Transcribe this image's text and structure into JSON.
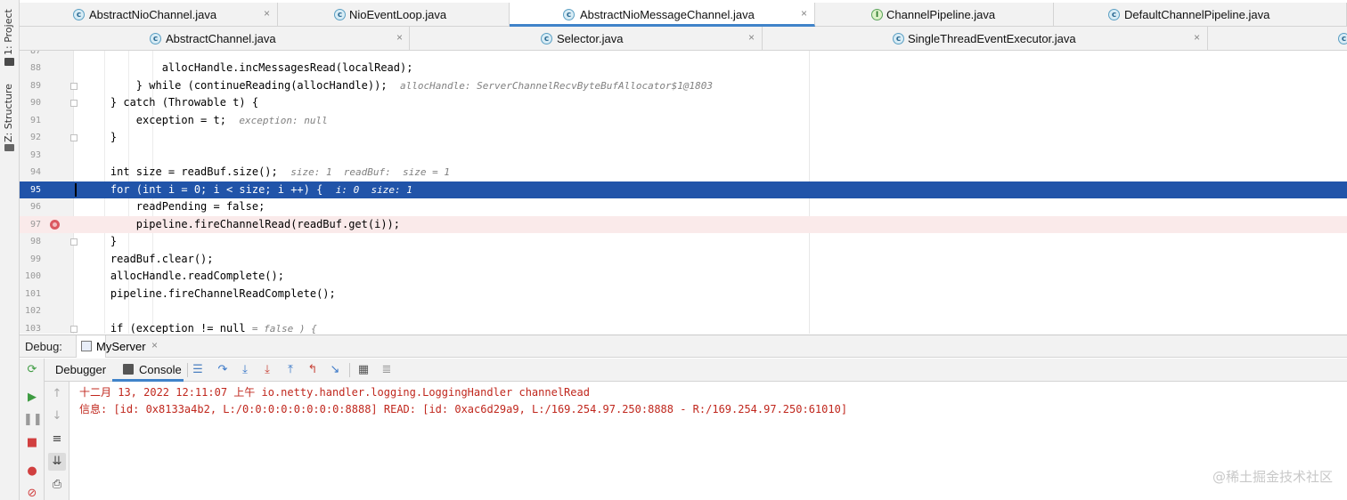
{
  "tool_windows": {
    "project": "1: Project",
    "structure": "Z: Structure"
  },
  "tabs_row1": [
    {
      "label": "AbstractNioChannel.java",
      "icon": "class-icon",
      "active": false
    },
    {
      "label": "NioEventLoop.java",
      "icon": "class-icon",
      "active": false
    },
    {
      "label": "AbstractNioMessageChannel.java",
      "icon": "class-icon",
      "active": true
    },
    {
      "label": "ChannelPipeline.java",
      "icon": "interface-icon",
      "active": false
    },
    {
      "label": "DefaultChannelPipeline.java",
      "icon": "class-icon",
      "active": false
    }
  ],
  "tabs_row2": [
    {
      "label": "AbstractChannel.java",
      "icon": "class-icon"
    },
    {
      "label": "Selector.java",
      "icon": "class-icon"
    },
    {
      "label": "SingleThreadEventExecutor.java",
      "icon": "class-icon"
    }
  ],
  "tab_close_glyph": "×",
  "editor": {
    "lines": [
      {
        "num": "88",
        "code": "            allocHandle.incMessagesRead(localRead);",
        "inline": ""
      },
      {
        "num": "89",
        "code": "        } while (continueReading(allocHandle));",
        "inline": "allocHandle: ServerChannelRecvByteBufAllocator$1@1803"
      },
      {
        "num": "90",
        "code": "    } catch (Throwable t) {",
        "inline": ""
      },
      {
        "num": "91",
        "code": "        exception = t;",
        "inline": "exception: null"
      },
      {
        "num": "92",
        "code": "    }",
        "inline": ""
      },
      {
        "num": "93",
        "code": "",
        "inline": ""
      },
      {
        "num": "94",
        "code": "    int size = readBuf.size();",
        "inline": "size: 1  readBuf:  size = 1"
      },
      {
        "num": "95",
        "code": "    for (int i = 0; i < size; i ++) {",
        "inline": "i: 0  size: 1"
      },
      {
        "num": "96",
        "code": "        readPending = false;",
        "inline": ""
      },
      {
        "num": "97",
        "code": "        pipeline.fireChannelRead(readBuf.get(i));",
        "inline": ""
      },
      {
        "num": "98",
        "code": "    }",
        "inline": ""
      },
      {
        "num": "99",
        "code": "    readBuf.clear();",
        "inline": ""
      },
      {
        "num": "100",
        "code": "    allocHandle.readComplete();",
        "inline": ""
      },
      {
        "num": "101",
        "code": "    pipeline.fireChannelReadComplete();",
        "inline": ""
      },
      {
        "num": "102",
        "code": "",
        "inline": ""
      },
      {
        "num": "103",
        "code": "    if (exception != null",
        "inline": "= false ) {"
      }
    ],
    "first_partial_line": "87",
    "execution_line": "95",
    "breakpoint_line": "97"
  },
  "debug": {
    "label": "Debug:",
    "session": "MyServer",
    "tabs": [
      "Debugger",
      "Console"
    ],
    "active_tab": "Console",
    "console_lines": [
      "十二月 13, 2022 12:11:07 上午 io.netty.handler.logging.LoggingHandler channelRead",
      "信息: [id: 0x8133a4b2, L:/0:0:0:0:0:0:0:0:8888] READ: [id: 0xac6d29a9, L:/169.254.97.250:8888 - R:/169.254.97.250:61010]"
    ]
  },
  "colors": {
    "execution_line_bg": "#2154a9",
    "breakpoint_line_bg": "#faeaea",
    "breakpoint_icon": "#db5860",
    "console_text": "#c0271d",
    "tab_accent": "#4083c9"
  },
  "watermark": "@稀土掘金技术社区"
}
